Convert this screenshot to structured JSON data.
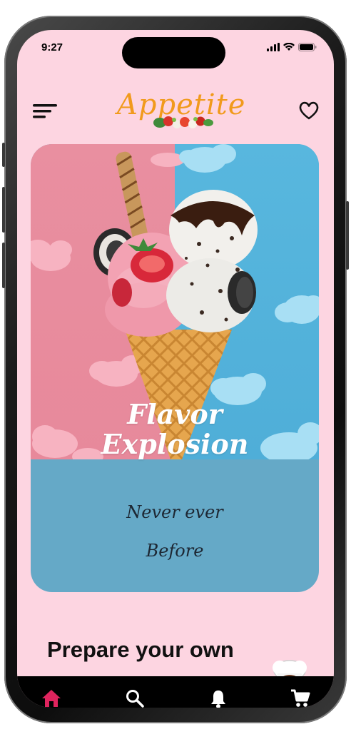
{
  "status_bar": {
    "time": "9:27",
    "icons": [
      "cellular-signal-icon",
      "wifi-icon",
      "battery-icon"
    ]
  },
  "header": {
    "logo_text": "Appetite",
    "menu_icon": "menu-icon",
    "favorite_icon": "heart-icon"
  },
  "hero": {
    "title_line1": "Flavor",
    "title_line2": "Explosion",
    "subtitle_line1": "Never ever",
    "subtitle_line2": "Before"
  },
  "promo": {
    "heading_visible": "Prepare your own"
  },
  "tab_bar": {
    "items": [
      {
        "name": "home",
        "icon": "home-icon",
        "active": true
      },
      {
        "name": "search",
        "icon": "search-icon",
        "active": false
      },
      {
        "name": "notifications",
        "icon": "bell-icon",
        "active": false
      },
      {
        "name": "cart",
        "icon": "cart-icon",
        "active": false
      }
    ]
  },
  "colors": {
    "background": "#fdd5e1",
    "logo": "#f19a1c",
    "hero_panel": "#65a9c7",
    "active_tab": "#e0245e",
    "tab_bar": "#000000"
  }
}
